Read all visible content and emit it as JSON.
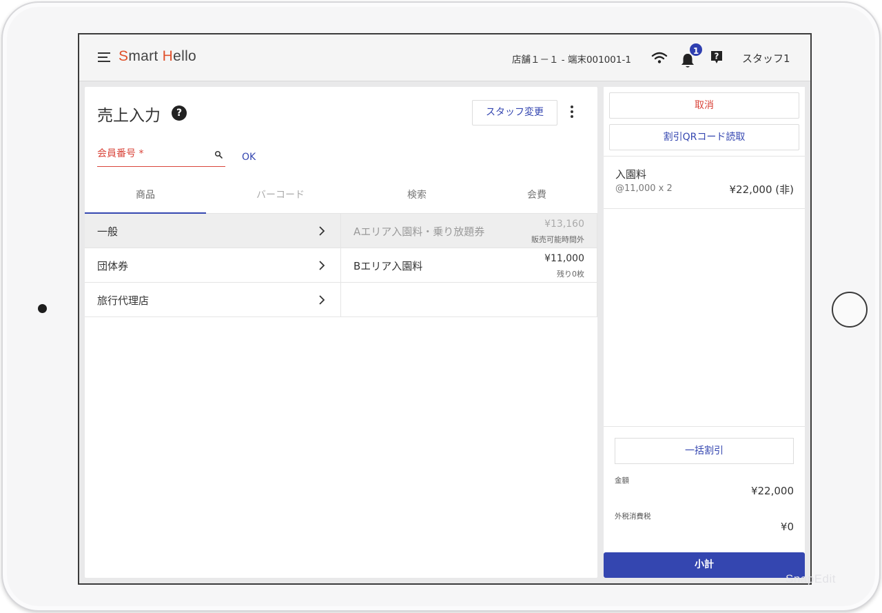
{
  "header": {
    "logo_part1": "S",
    "logo_part2": "mart ",
    "logo_part3": "H",
    "logo_part4": "ello",
    "store_terminal": "店舗１－１ - 端末001001-1",
    "notification_count": "1",
    "user": "スタッフ1"
  },
  "page": {
    "title": "売上入力",
    "help_glyph": "?",
    "staff_change_label": "スタッフ変更"
  },
  "member": {
    "placeholder": "会員番号 *",
    "ok_label": "OK"
  },
  "tabs": [
    {
      "label": "商品"
    },
    {
      "label": "バーコード"
    },
    {
      "label": "検索"
    },
    {
      "label": "会費"
    }
  ],
  "categories": [
    {
      "label": "一般"
    },
    {
      "label": "団体券"
    },
    {
      "label": "旅行代理店"
    }
  ],
  "products": [
    {
      "name": "Aエリア入園料・乗り放題券",
      "price": "¥13,160",
      "note": "販売可能時間外"
    },
    {
      "name": "Bエリア入園料",
      "price": "¥11,000",
      "note": "残り0枚"
    }
  ],
  "side": {
    "cancel_label": "取消",
    "qr_label": "割引QRコード読取",
    "line_items": [
      {
        "name": "入園料",
        "detail": "@11,000 x 2",
        "total": "¥22,000 (非)"
      }
    ],
    "bulk_discount_label": "一括割引",
    "amount_label": "金額",
    "amount_value": "¥22,000",
    "tax_label": "外税消費税",
    "tax_value": "¥0",
    "subtotal_label": "小計"
  },
  "watermark": "SnapEdit",
  "colors": {
    "accent_blue": "#3446b0",
    "error_red": "#d9443a",
    "logo_orange": "#e0502a"
  }
}
